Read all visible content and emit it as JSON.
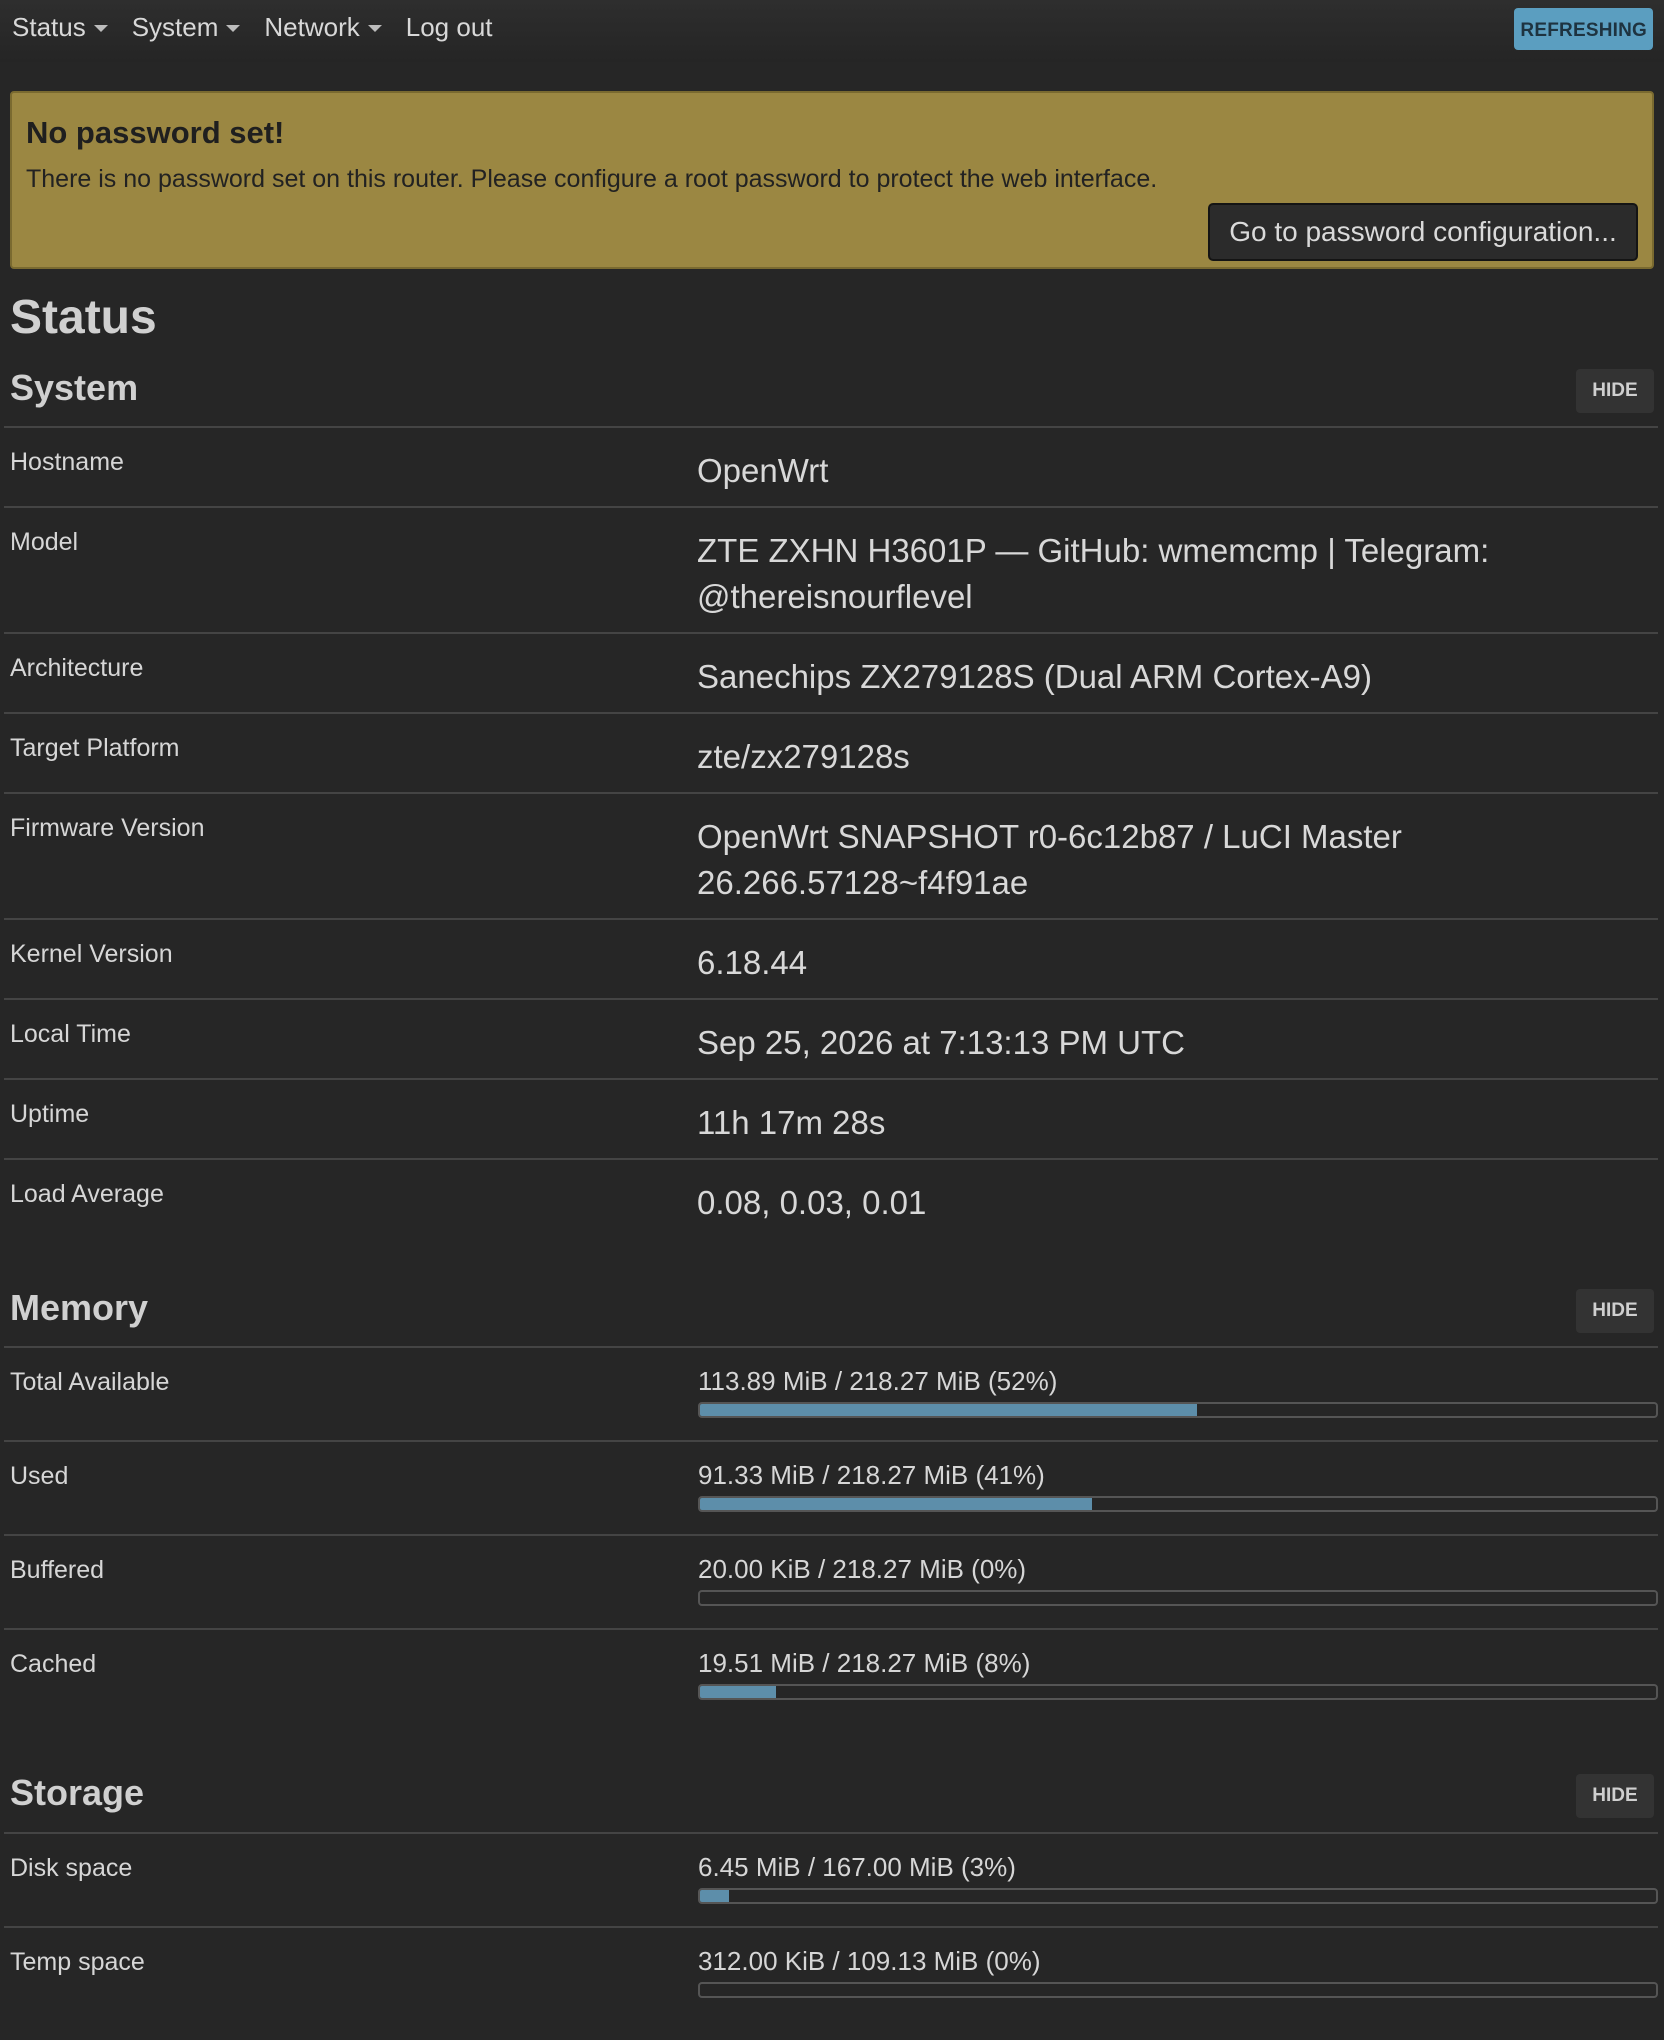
{
  "nav": {
    "menu": [
      {
        "label": "Status",
        "dropdown": true
      },
      {
        "label": "System",
        "dropdown": true
      },
      {
        "label": "Network",
        "dropdown": true
      },
      {
        "label": "Log out",
        "dropdown": false
      }
    ],
    "refresh_badge": "REFRESHING"
  },
  "alert": {
    "title": "No password set!",
    "text": "There is no password set on this router. Please configure a root password to protect the web interface.",
    "button": "Go to password configuration..."
  },
  "page_title": "Status",
  "sections": {
    "system": {
      "title": "System",
      "hide_label": "HIDE",
      "rows": [
        {
          "label": "Hostname",
          "value": "OpenWrt"
        },
        {
          "label": "Model",
          "value": "ZTE ZXHN H3601P — GitHub: wmemcmp | Telegram: @thereisnourflevel"
        },
        {
          "label": "Architecture",
          "value": "Sanechips ZX279128S (Dual ARM Cortex-A9)"
        },
        {
          "label": "Target Platform",
          "value": "zte/zx279128s"
        },
        {
          "label": "Firmware Version",
          "value": "OpenWrt SNAPSHOT r0-6c12b87 / LuCI Master 26.266.57128~f4f91ae"
        },
        {
          "label": "Kernel Version",
          "value": "6.18.44"
        },
        {
          "label": "Local Time",
          "value": "Sep 25, 2026 at 7:13:13 PM UTC"
        },
        {
          "label": "Uptime",
          "value": "11h 17m 28s"
        },
        {
          "label": "Load Average",
          "value": "0.08, 0.03, 0.01"
        }
      ]
    },
    "memory": {
      "title": "Memory",
      "hide_label": "HIDE",
      "rows": [
        {
          "label": "Total Available",
          "value": "113.89 MiB / 218.27 MiB (52%)",
          "percent": 52
        },
        {
          "label": "Used",
          "value": "91.33 MiB / 218.27 MiB (41%)",
          "percent": 41
        },
        {
          "label": "Buffered",
          "value": "20.00 KiB / 218.27 MiB (0%)",
          "percent": 0
        },
        {
          "label": "Cached",
          "value": "19.51 MiB / 218.27 MiB (8%)",
          "percent": 8
        }
      ]
    },
    "storage": {
      "title": "Storage",
      "hide_label": "HIDE",
      "rows": [
        {
          "label": "Disk space",
          "value": "6.45 MiB / 167.00 MiB (3%)",
          "percent": 3
        },
        {
          "label": "Temp space",
          "value": "312.00 KiB / 109.13 MiB (0%)",
          "percent": 0
        }
      ]
    }
  },
  "colors": {
    "background": "#262626",
    "alert": "#9b8742",
    "accent": "#5b9ec0",
    "progress_fill": "#5d8eaa"
  }
}
